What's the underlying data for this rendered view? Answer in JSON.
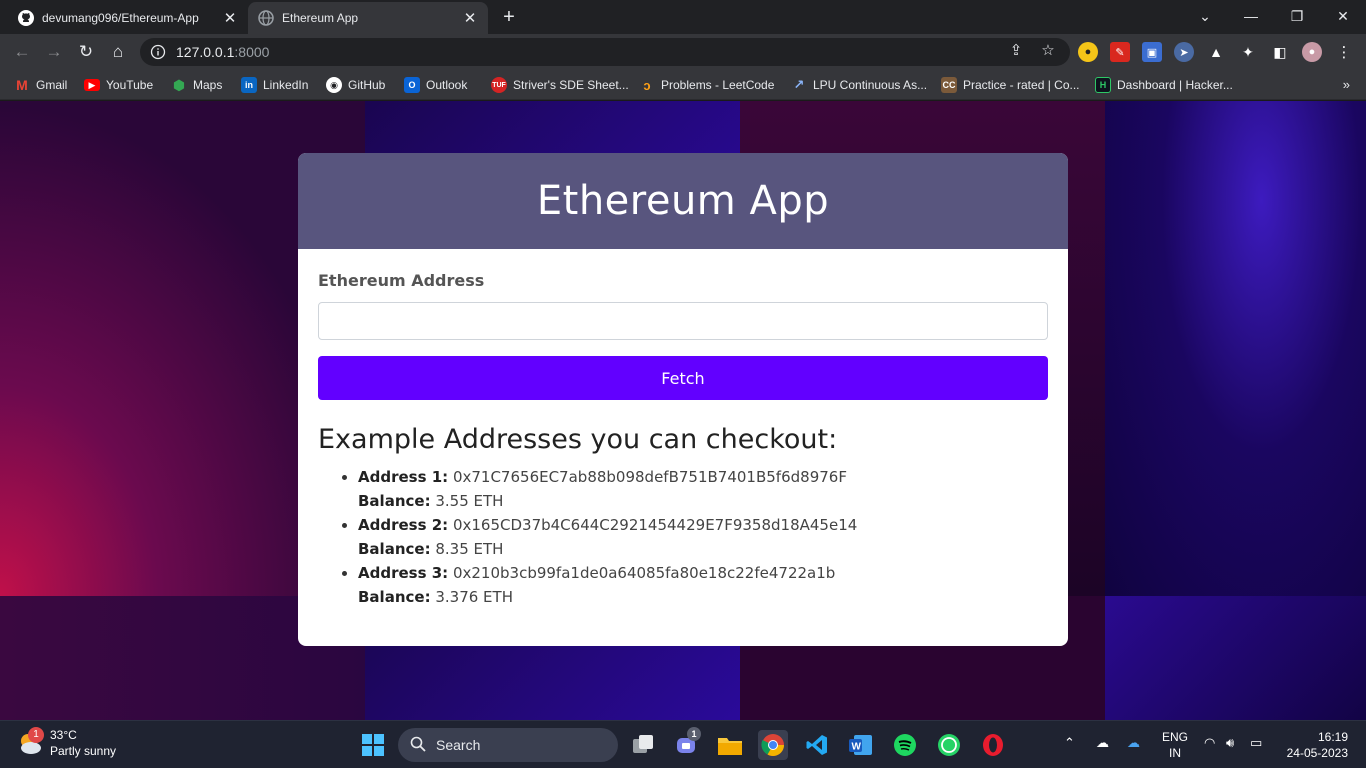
{
  "browser": {
    "tabs": [
      {
        "title": "devumang096/Ethereum-App",
        "active": false
      },
      {
        "title": "Ethereum App",
        "active": true
      }
    ],
    "new_tab": "+",
    "url_host": "127.0.0.1",
    "url_port": ":8000",
    "bookmarks": [
      {
        "label": "Gmail"
      },
      {
        "label": "YouTube"
      },
      {
        "label": "Maps"
      },
      {
        "label": "LinkedIn"
      },
      {
        "label": "GitHub"
      },
      {
        "label": "Outlook"
      },
      {
        "label": "Striver's SDE Sheet..."
      },
      {
        "label": "Problems - LeetCode"
      },
      {
        "label": "LPU Continuous As..."
      },
      {
        "label": "Practice - rated | Co..."
      },
      {
        "label": "Dashboard | Hacker..."
      }
    ],
    "bookmarks_more": "»"
  },
  "app": {
    "title": "Ethereum App",
    "address_label": "Ethereum Address",
    "address_value": "",
    "fetch_label": "Fetch",
    "examples_title": "Example Addresses you can checkout:",
    "examples": [
      {
        "address_label": "Address 1:",
        "address": "0x71C7656EC7ab88b098defB751B7401B5f6d8976F",
        "balance_label": "Balance:",
        "balance": "3.55 ETH"
      },
      {
        "address_label": "Address 2:",
        "address": "0x165CD37b4C644C2921454429E7F9358d18A45e14",
        "balance_label": "Balance:",
        "balance": "8.35 ETH"
      },
      {
        "address_label": "Address 3:",
        "address": "0x210b3cb99fa1de0a64085fa80e18c22fe4722a1b",
        "balance_label": "Balance:",
        "balance": "3.376 ETH"
      }
    ]
  },
  "taskbar": {
    "weather_temp": "33°C",
    "weather_desc": "Partly sunny",
    "weather_badge": "1",
    "search_label": "Search",
    "teams_badge": "1",
    "lang_top": "ENG",
    "lang_bottom": "IN",
    "time": "16:19",
    "date": "24-05-2023"
  },
  "colors": {
    "header": "#58557e",
    "fetch_button": "#6200ff",
    "chrome_dark": "#202124",
    "chrome_toolbar": "#35363a"
  }
}
